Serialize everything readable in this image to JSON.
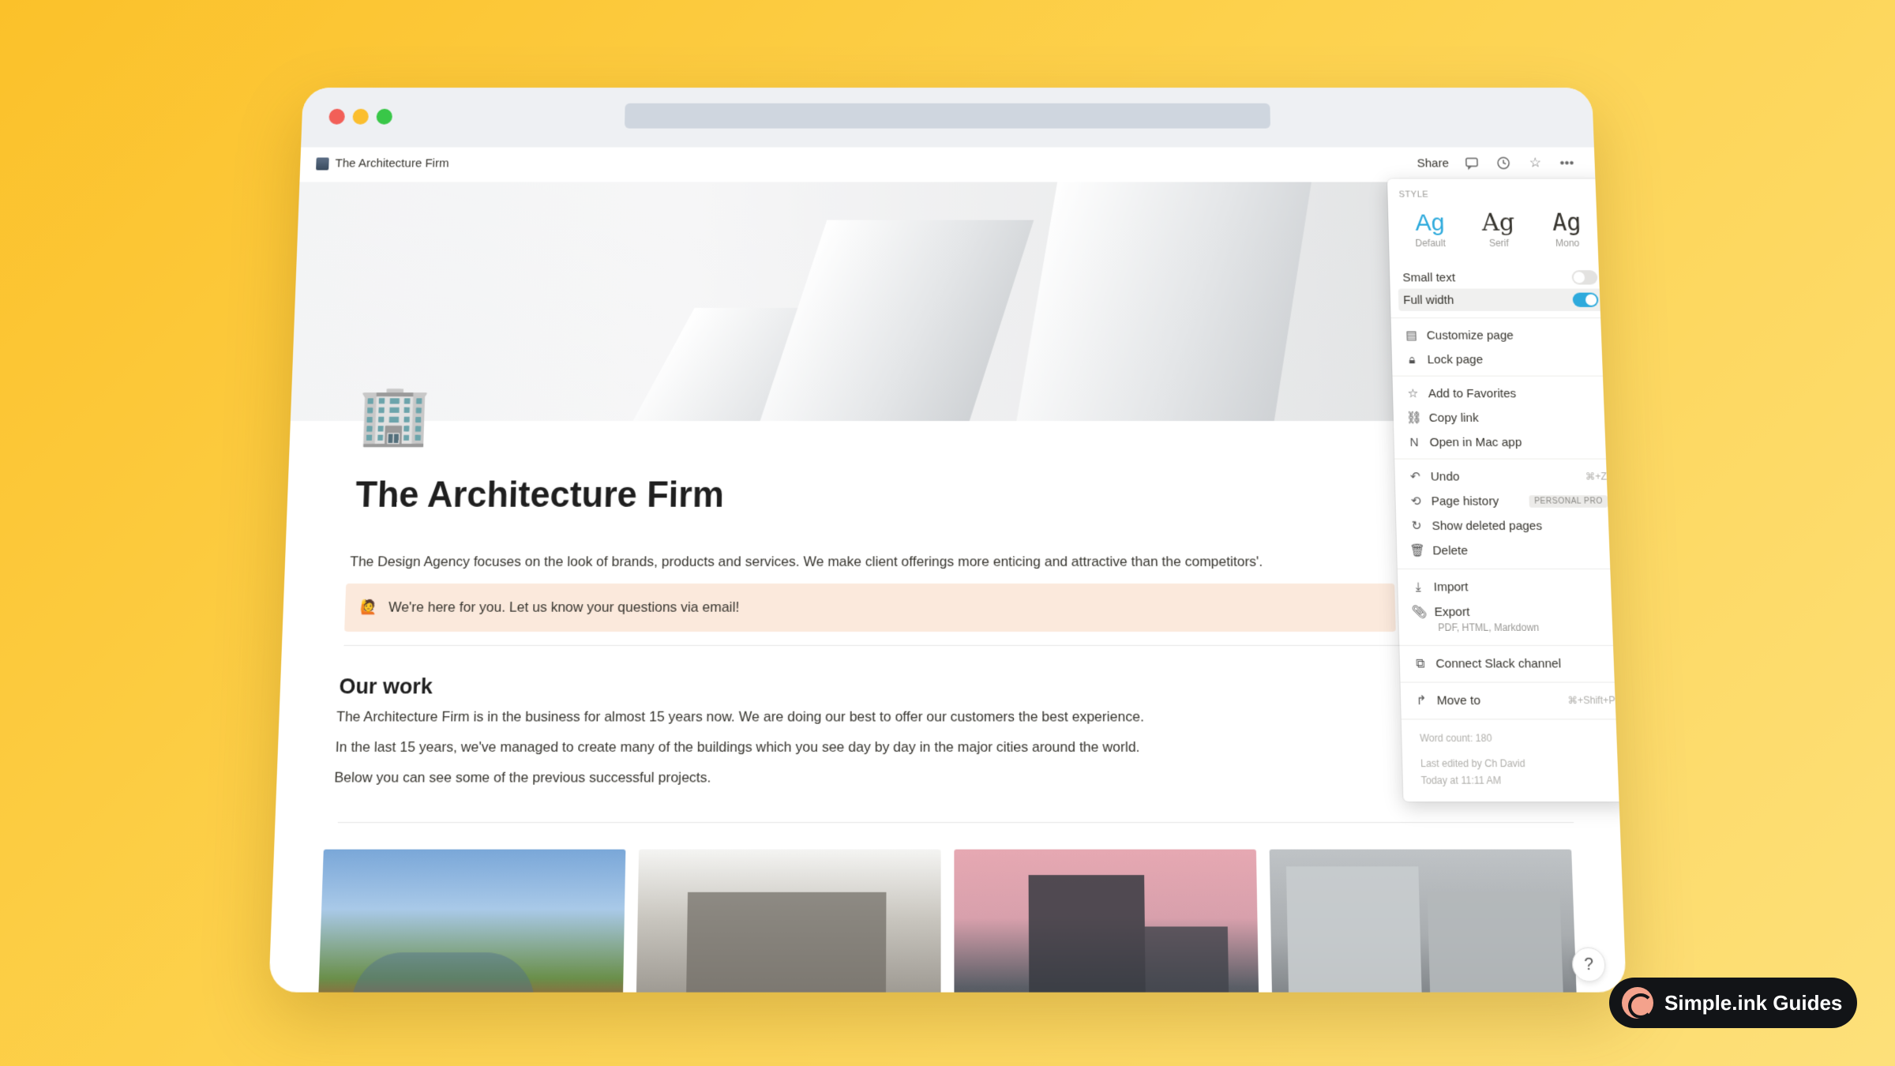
{
  "app": {
    "page_title": "The Architecture Firm",
    "share_label": "Share"
  },
  "page": {
    "icon": "office-building-icon",
    "title": "The Architecture Firm",
    "description": "The Design Agency focuses on the look of brands, products and services. We make client offerings more enticing and attractive than the competitors'.",
    "callout_emoji": "🙋",
    "callout_text": "We're here for you. Let us know your questions via email!",
    "section_heading": "Our work",
    "paragraphs": [
      "The Architecture Firm is in the business for almost 15 years now. We are doing our best to offer our customers the best experience.",
      "In the last 15 years, we've managed to create many of the buildings which you see day by day in the major cities around the world.",
      "Below you can see some of the previous successful projects."
    ],
    "help_label": "?"
  },
  "menu": {
    "style_label": "STYLE",
    "styles": [
      {
        "glyph": "Ag",
        "label": "Default"
      },
      {
        "glyph": "Ag",
        "label": "Serif"
      },
      {
        "glyph": "Ag",
        "label": "Mono"
      }
    ],
    "small_text": "Small text",
    "full_width": "Full width",
    "customize_page": "Customize page",
    "lock_page": "Lock page",
    "add_to_favorites": "Add to Favorites",
    "copy_link": "Copy link",
    "open_in_mac_app": "Open in Mac app",
    "undo": "Undo",
    "undo_shortcut": "⌘+Z",
    "page_history": "Page history",
    "page_history_badge": "PERSONAL PRO",
    "show_deleted_pages": "Show deleted pages",
    "delete": "Delete",
    "import": "Import",
    "export": "Export",
    "export_sub": "PDF, HTML, Markdown",
    "connect_slack": "Connect Slack channel",
    "move_to": "Move to",
    "move_to_shortcut": "⌘+Shift+P",
    "word_count": "Word count: 180",
    "last_edited": "Last edited by Ch David",
    "last_edited_time": "Today at 11:11 AM"
  },
  "brand": {
    "guide_label": "Simple.ink Guides"
  }
}
